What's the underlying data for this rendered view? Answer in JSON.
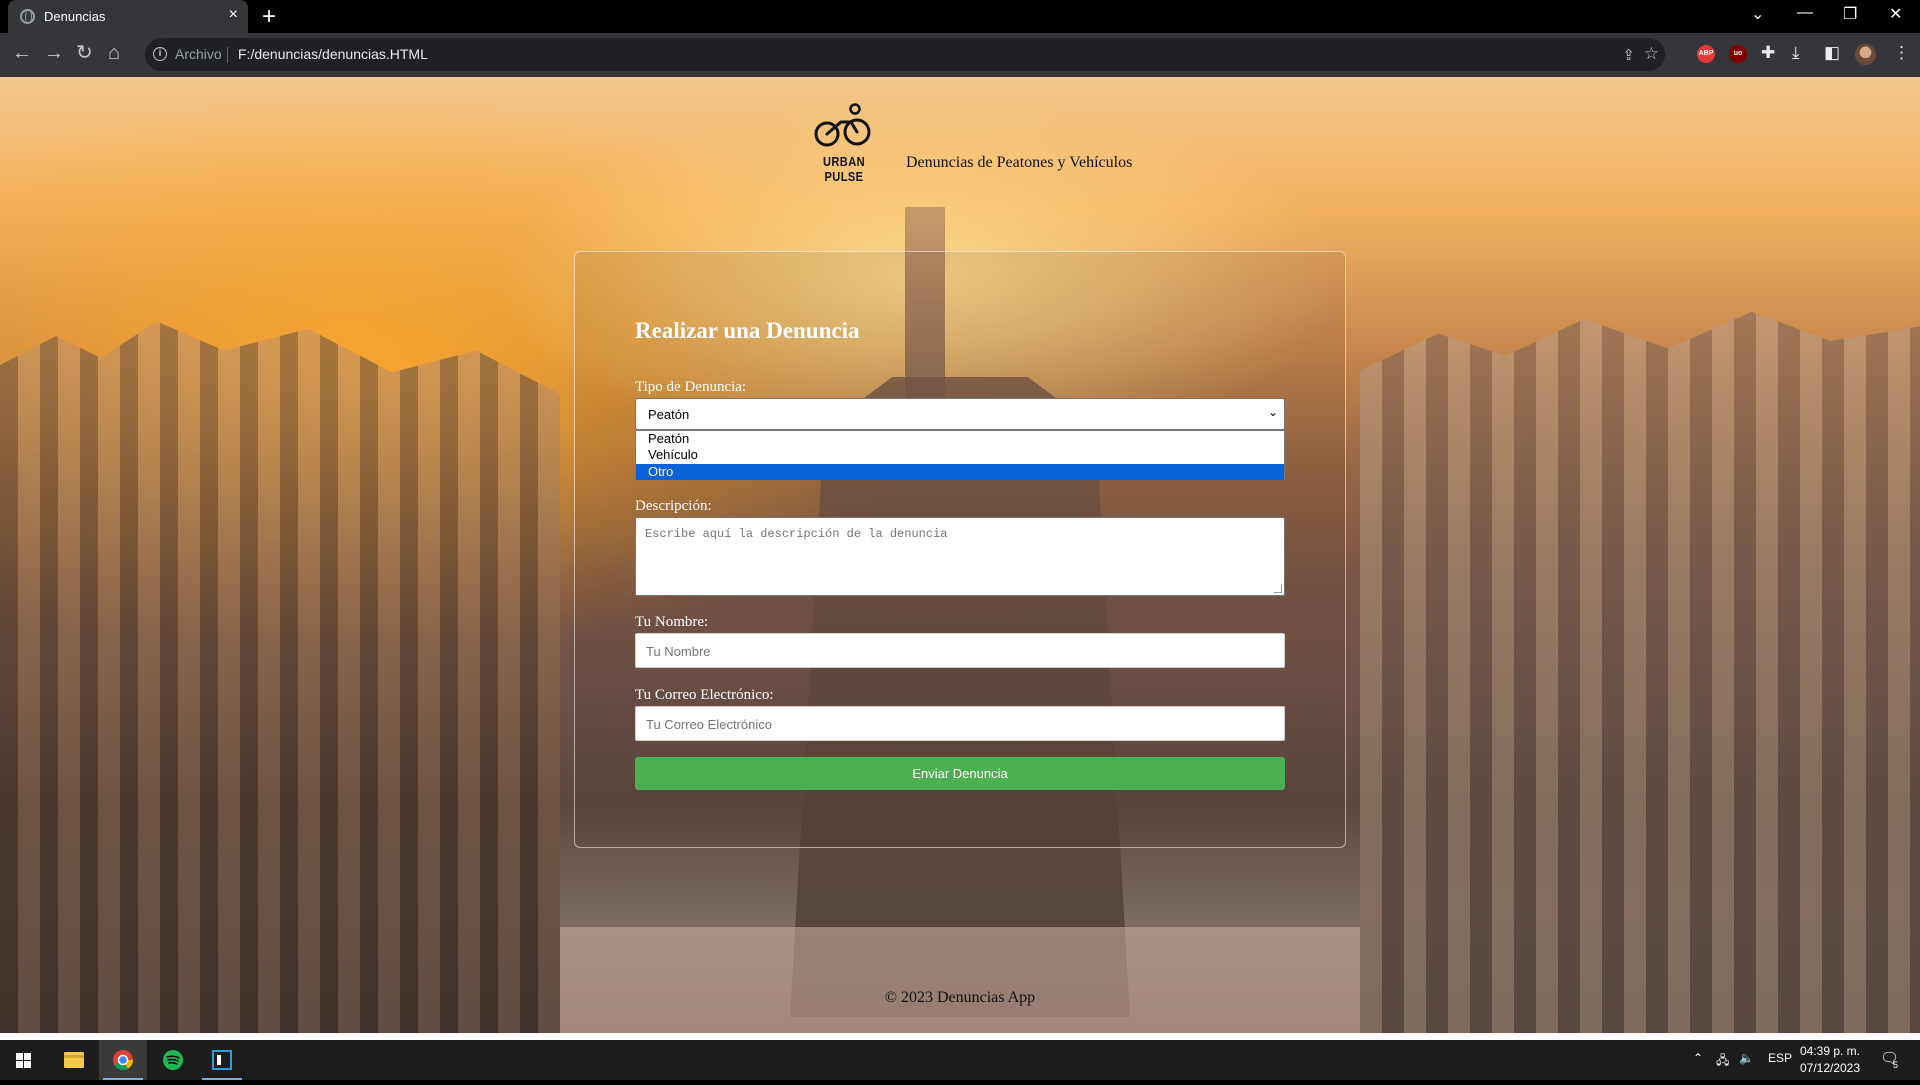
{
  "browser": {
    "tab_title": "Denuncias",
    "tab_close": "×",
    "new_tab": "+",
    "scheme_label": "Archivo",
    "url": "F:/denuncias/denuncias.HTML",
    "window_controls": {
      "dropdown": "⌄",
      "minimize": "—",
      "restore": "❐",
      "close": "✕"
    },
    "extensions": [
      "ABP",
      "uo"
    ]
  },
  "page": {
    "brand_name": "URBAN PULSE",
    "header_subtitle": "Denuncias de Peatones y Vehículos",
    "form": {
      "title": "Realizar una Denuncia",
      "type_label": "Tipo de Denuncia:",
      "type_selected": "Peatón",
      "type_options": [
        "Peatón",
        "Vehículo",
        "Otro"
      ],
      "type_highlighted": "Otro",
      "description_label": "Descripción:",
      "description_placeholder": "Escribe aquí la descripción de la denuncia",
      "name_label": "Tu Nombre:",
      "name_placeholder": "Tu Nombre",
      "email_label": "Tu Correo Electrónico:",
      "email_placeholder": "Tu Correo Electrónico",
      "submit_label": "Enviar Denuncia"
    },
    "footer": "© 2023 Denuncias App"
  },
  "taskbar": {
    "language": "ESP",
    "time": "04:39 p. m.",
    "date": "07/12/2023",
    "notifications_count": "5"
  },
  "colors": {
    "submit_button": "#4caf50",
    "option_highlight": "#0b61d8",
    "browser_toolbar": "#35363a"
  }
}
